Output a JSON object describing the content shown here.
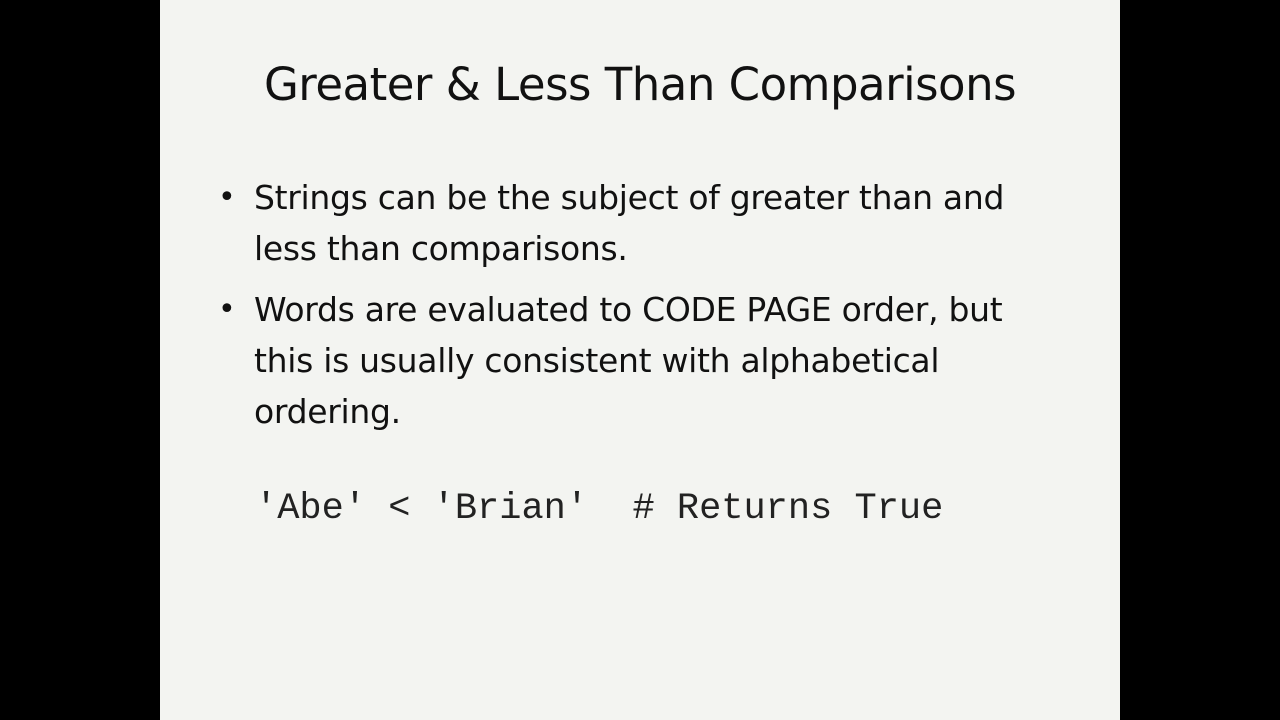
{
  "slide": {
    "title": "Greater & Less Than Comparisons",
    "bullet_marker": "•",
    "bullets": [
      {
        "text": "Strings can be the subject of greater than and less than comparisons."
      },
      {
        "text": "Words are evaluated to CODE PAGE order, but this is usually consistent with alphabetical ordering."
      }
    ],
    "code": "'Abe' < 'Brian'  # Returns True"
  },
  "colors": {
    "background": "#000000",
    "slide_background": "#f3f4f1",
    "text": "#111111"
  }
}
